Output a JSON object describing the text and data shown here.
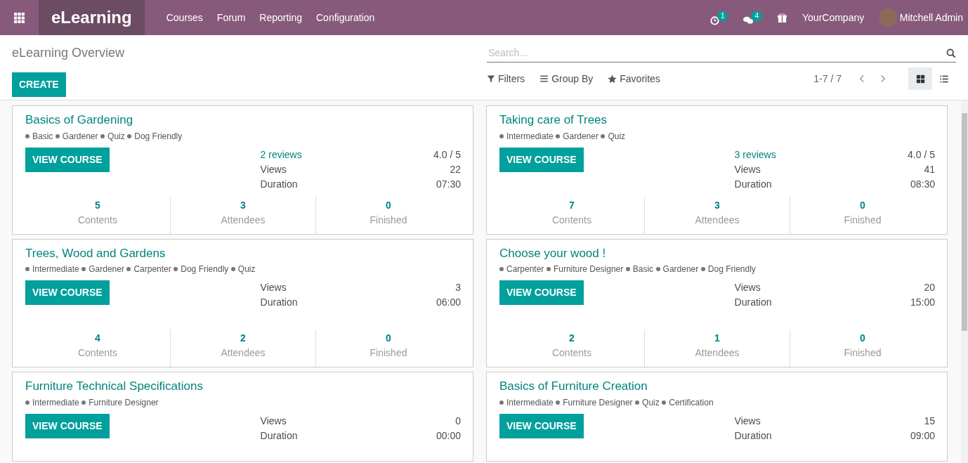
{
  "navbar": {
    "brand": "eLearning",
    "menu": [
      "Courses",
      "Forum",
      "Reporting",
      "Configuration"
    ],
    "activity_count": "1",
    "message_count": "4",
    "company": "YourCompany",
    "user": "Mitchell Admin"
  },
  "control_panel": {
    "title": "eLearning Overview",
    "create": "CREATE",
    "search": {
      "placeholder": "Search..."
    },
    "filters": "Filters",
    "group_by": "Group By",
    "favorites": "Favorites",
    "pager": "1-7 / 7",
    "views": [
      {
        "kind": "kanban",
        "selected": true
      },
      {
        "kind": "list",
        "selected": false
      }
    ]
  },
  "courses": [
    {
      "title": "Basics of Gardening",
      "tags": [
        "Basic",
        "Gardener",
        "Quiz",
        "Dog Friendly"
      ],
      "button": "VIEW COURSE",
      "reviews": "2 reviews",
      "rating": "4.0 / 5",
      "views_label": "Views",
      "views": "22",
      "duration_label": "Duration",
      "duration": "07:30",
      "stats": [
        {
          "value": "5",
          "label": "Contents"
        },
        {
          "value": "3",
          "label": "Attendees"
        },
        {
          "value": "0",
          "label": "Finished"
        }
      ]
    },
    {
      "title": "Taking care of Trees",
      "tags": [
        "Intermediate",
        "Gardener",
        "Quiz"
      ],
      "button": "VIEW COURSE",
      "reviews": "3 reviews",
      "rating": "4.0 / 5",
      "views_label": "Views",
      "views": "41",
      "duration_label": "Duration",
      "duration": "08:30",
      "stats": [
        {
          "value": "7",
          "label": "Contents"
        },
        {
          "value": "3",
          "label": "Attendees"
        },
        {
          "value": "0",
          "label": "Finished"
        }
      ]
    },
    {
      "title": "Trees, Wood and Gardens",
      "tags": [
        "Intermediate",
        "Gardener",
        "Carpenter",
        "Dog Friendly",
        "Quiz"
      ],
      "button": "VIEW COURSE",
      "views_label": "Views",
      "views": "3",
      "duration_label": "Duration",
      "duration": "06:00",
      "stats": [
        {
          "value": "4",
          "label": "Contents"
        },
        {
          "value": "2",
          "label": "Attendees"
        },
        {
          "value": "0",
          "label": "Finished"
        }
      ]
    },
    {
      "title": "Choose your wood !",
      "tags": [
        "Carpenter",
        "Furniture Designer",
        "Basic",
        "Gardener",
        "Dog Friendly"
      ],
      "button": "VIEW COURSE",
      "views_label": "Views",
      "views": "20",
      "duration_label": "Duration",
      "duration": "15:00",
      "stats": [
        {
          "value": "2",
          "label": "Contents"
        },
        {
          "value": "1",
          "label": "Attendees"
        },
        {
          "value": "0",
          "label": "Finished"
        }
      ]
    },
    {
      "title": "Furniture Technical Specifications",
      "tags": [
        "Intermediate",
        "Furniture Designer"
      ],
      "button": "VIEW COURSE",
      "views_label": "Views",
      "views": "0",
      "duration_label": "Duration",
      "duration": "00:00"
    },
    {
      "title": "Basics of Furniture Creation",
      "tags": [
        "Intermediate",
        "Furniture Designer",
        "Quiz",
        "Certification"
      ],
      "button": "VIEW COURSE",
      "views_label": "Views",
      "views": "15",
      "duration_label": "Duration",
      "duration": "09:00"
    }
  ]
}
